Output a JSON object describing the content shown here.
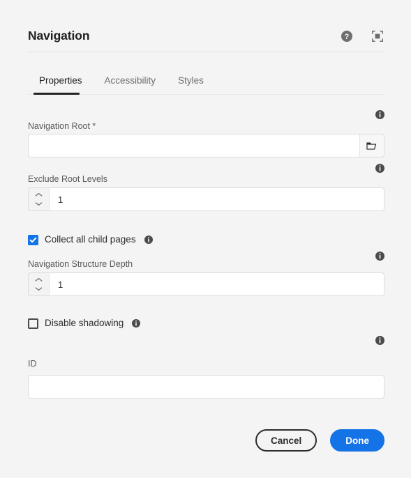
{
  "header": {
    "title": "Navigation",
    "help_icon": "help-circle-icon",
    "fullscreen_icon": "fullscreen-icon"
  },
  "tabs": [
    {
      "label": "Properties",
      "active": true
    },
    {
      "label": "Accessibility",
      "active": false
    },
    {
      "label": "Styles",
      "active": false
    }
  ],
  "fields": {
    "navigation_root": {
      "label": "Navigation Root *",
      "value": "",
      "placeholder": "",
      "browse_icon": "folder-icon",
      "info_icon": "info-icon"
    },
    "exclude_root_levels": {
      "label": "Exclude Root Levels",
      "value": "1",
      "placeholder": "",
      "increment_icon": "chevron-up-icon",
      "decrement_icon": "chevron-down-icon",
      "info_icon": "info-icon"
    },
    "collect_all_child_pages": {
      "label": "Collect all child pages",
      "checked": true,
      "info_icon": "info-icon"
    },
    "navigation_structure_depth": {
      "label": "Navigation Structure Depth",
      "value": "1",
      "placeholder": "",
      "increment_icon": "chevron-up-icon",
      "decrement_icon": "chevron-down-icon",
      "info_icon": "info-icon"
    },
    "disable_shadowing": {
      "label": "Disable shadowing",
      "checked": false,
      "info_icon": "info-icon"
    },
    "id": {
      "label": "ID",
      "value": "",
      "placeholder": "",
      "info_icon": "info-icon"
    }
  },
  "footer": {
    "cancel_label": "Cancel",
    "done_label": "Done"
  },
  "colors": {
    "accent": "#1473E6",
    "background": "#F4F4F4",
    "text": "#2C2C2C",
    "label": "#585858",
    "border": "#DCDCDC",
    "tab_indicator": "#242424"
  }
}
